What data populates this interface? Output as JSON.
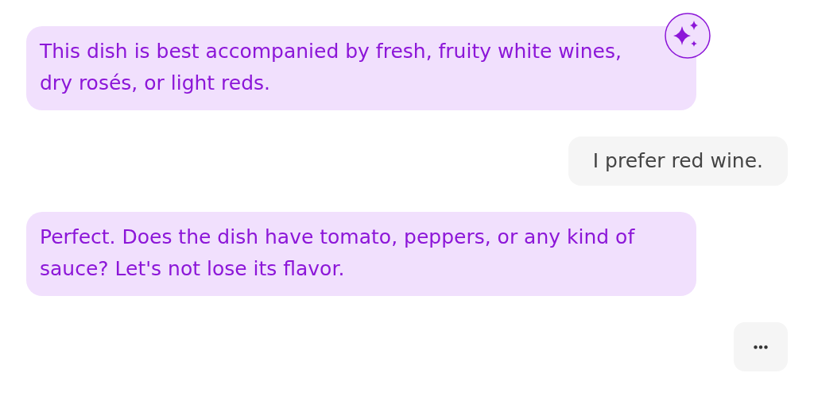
{
  "messages": [
    {
      "kind": "bot",
      "text": "This dish is best accompanied by fresh, fruity white wines, dry rosés, or light reds.",
      "assistant_icon": true
    },
    {
      "kind": "user",
      "text": "I prefer red wine."
    },
    {
      "kind": "bot",
      "text": "Perfect. Does the dish have tomato, peppers, or any kind of sauce? Let's not lose its flavor.",
      "assistant_icon": false
    },
    {
      "kind": "typing"
    }
  ]
}
